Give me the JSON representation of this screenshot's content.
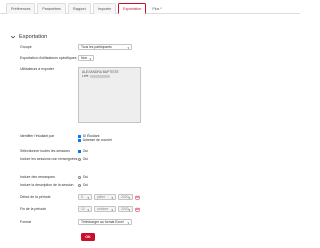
{
  "tabs": [
    {
      "label": "Préférences",
      "active": false
    },
    {
      "label": "Paramètres",
      "active": false
    },
    {
      "label": "Rapport",
      "active": false
    },
    {
      "label": "Importer",
      "active": false
    },
    {
      "label": "Exportation",
      "active": true
    },
    {
      "label": "Plus",
      "active": false
    }
  ],
  "section": {
    "title": "Exportation"
  },
  "form": {
    "group": {
      "label": "Groupe",
      "value": "Tous les participants"
    },
    "user_export": {
      "label": "Exportation d'utilisateurs spécifiques",
      "value": "Non"
    },
    "users": {
      "label": "Utilisateurs à exporter",
      "options": [
        "ALEXANDRA BAPTISTE",
        "Lefe"
      ]
    },
    "identify": {
      "label": "Identifier l'étudiant par",
      "options": [
        {
          "label": "ID Étudiant",
          "checked": true
        },
        {
          "label": "Adresse de courriel",
          "checked": true
        }
      ]
    },
    "all_sessions": {
      "label": "Sélectionner toutes les sessions",
      "option": "Oui",
      "checked": true
    },
    "no_response": {
      "label": "Inclure les sessions non renseignées",
      "option": "Oui",
      "checked": false
    },
    "notes": {
      "label": "Inclure des remarques",
      "option": "Oui",
      "checked": false
    },
    "session_desc": {
      "label": "Inclure la description de la session",
      "option": "Oui",
      "checked": false
    },
    "start": {
      "label": "Début de la période",
      "day": "5",
      "month": "juillet",
      "year": "2020"
    },
    "end": {
      "label": "Fin de la période",
      "day": "12",
      "month": "octobre",
      "year": "2020"
    },
    "format": {
      "label": "Format",
      "value": "Télécharger au format Excel"
    }
  },
  "ok_label": "OK",
  "colors": {
    "accent": "#c8102e",
    "check": "#0075ff"
  }
}
